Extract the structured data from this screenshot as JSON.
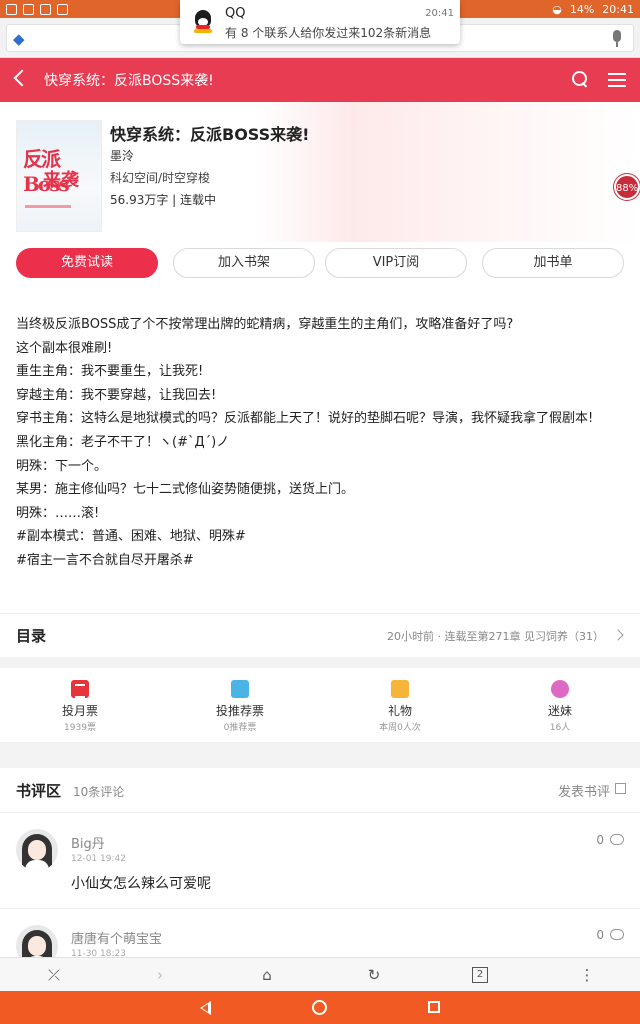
{
  "status_bar": {
    "battery": "14%",
    "time": "20:41"
  },
  "notification": {
    "app": "QQ",
    "time": "20:41",
    "message": "有 8 个联系人给你发过来102条新消息"
  },
  "app_bar": {
    "title": "快穿系统：反派BOSS来袭!"
  },
  "book": {
    "cover_text_1": "反派Boss",
    "cover_text_2": "来袭",
    "title": "快穿系统：反派BOSS来袭!",
    "author": "墨泠",
    "category": "科幻空间/时空穿梭",
    "meta": "56.93万字 | 连载中",
    "score_badge": "88%"
  },
  "actions": {
    "free_read": "免费试读",
    "add_shelf": "加入书架",
    "vip": "VIP订阅",
    "add_list": "加书单"
  },
  "intro": [
    "当终极反派BOSS成了个不按常理出牌的蛇精病，穿越重生的主角们，攻略准备好了吗?",
    "这个副本很难刷!",
    "重生主角：我不要重生，让我死!",
    "穿越主角：我不要穿越，让我回去!",
    "穿书主角：这特么是地狱模式的吗？反派都能上天了！说好的垫脚石呢？导演，我怀疑我拿了假剧本!",
    "黑化主角：老子不干了！ヽ(#`Д´)ノ",
    "明殊：下一个。",
    "某男：施主修仙吗？七十二式修仙姿势随便挑，送货上门。",
    "明殊：……滚!",
    "#副本模式：普通、困难、地狱、明殊#",
    "#宿主一言不合就自尽开屠杀#"
  ],
  "toc": {
    "label": "目录",
    "latest": "20小时前 · 连载至第271章 见习饲养（31）"
  },
  "stats": [
    {
      "label": "投月票",
      "sub": "1939票",
      "icon": "monthly-ticket-icon",
      "color": "#e6333c"
    },
    {
      "label": "投推荐票",
      "sub": "0推荐票",
      "icon": "recommend-ticket-icon",
      "color": "#4bb4e6"
    },
    {
      "label": "礼物",
      "sub": "本周0人次",
      "icon": "gift-icon",
      "color": "#f6b53a"
    },
    {
      "label": "迷妹",
      "sub": "16人",
      "icon": "fan-icon",
      "color": "#dd69c4"
    }
  ],
  "reviews_section": {
    "title": "书评区",
    "count": "10条评论",
    "write": "发表书评"
  },
  "reviews": [
    {
      "name": "Big丹",
      "time": "12-01 19:42",
      "text": "小仙女怎么辣么可爱呢",
      "likes": "0"
    },
    {
      "name": "唐唐有个萌宝宝",
      "time": "11-30 18:23",
      "text": "",
      "likes": "0"
    }
  ],
  "toolbar": {
    "close_tab": "⤫",
    "forward": "›",
    "home": "⌂",
    "refresh": "↻",
    "tabs": "2",
    "more": "⋮"
  },
  "colors": {
    "brand_red": "#e73c52",
    "status_orange": "#e0652a",
    "nav_orange": "#f15a22"
  }
}
